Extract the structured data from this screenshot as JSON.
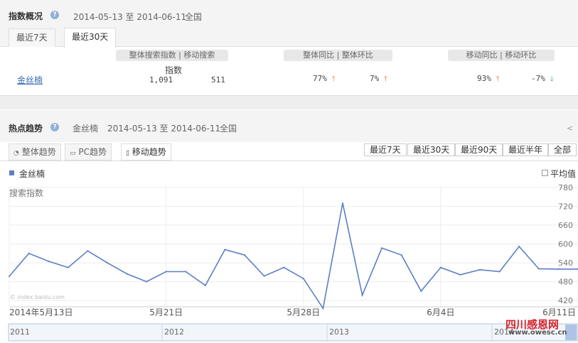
{
  "overview": {
    "title": "指数概况",
    "date_range": "2014-05-13 至 2014-06-11",
    "region": "全国",
    "tabs": [
      "最近7天",
      "最近30天"
    ],
    "active_tab": "最近30天",
    "col_headers": {
      "index": "整体搜索指数 | 移动搜索",
      "index_sub": "指数",
      "yoy_mom": "整体同比 | 整体环比",
      "mobile": "移动同比 | 移动环比"
    },
    "row": {
      "keyword": "金丝楠",
      "overall_index": "1,091",
      "mobile_index": "511",
      "overall_yoy": "77%",
      "overall_mom": "7%",
      "mobile_yoy": "93%",
      "mobile_mom": "-7%"
    }
  },
  "trend": {
    "title": "热点趋势",
    "keyword": "金丝楠",
    "date_range": "2014-05-13 至 2014-06-11",
    "region": "全国",
    "tabs": [
      "整体趋势",
      "PC趋势",
      "移动趋势"
    ],
    "active_tab": "移动趋势",
    "ranges": [
      "最近7天",
      "最近30天",
      "最近90天",
      "最近半年",
      "全部"
    ],
    "legend": "金丝楠",
    "avg_label": "平均值",
    "y_title": "搜索指数",
    "watermark": "© index.baidu.com",
    "navigator_years": [
      "2011",
      "2012",
      "2013",
      "2014"
    ]
  },
  "site_watermark": {
    "name": "四川感恩网",
    "url": "www.owesc.cn"
  },
  "chart_data": {
    "type": "line",
    "title": "",
    "ylabel": "搜索指数",
    "xlabel": "",
    "ylim": [
      400,
      780
    ],
    "yticks": [
      420,
      480,
      540,
      600,
      660,
      720,
      780
    ],
    "x_tick_labels": [
      "2014年5月13日",
      "5月21日",
      "5月28日",
      "6月4日",
      "6月11日"
    ],
    "x_tick_days": [
      0,
      8,
      15,
      22,
      29
    ],
    "grid": true,
    "color": "#5c7fc5",
    "series": [
      {
        "name": "金丝楠",
        "x": [
          0,
          1,
          2,
          3,
          4,
          5,
          6,
          7,
          8,
          9,
          10,
          11,
          12,
          13,
          14,
          15,
          16,
          17,
          18,
          19,
          20,
          21,
          22,
          23,
          24,
          25,
          26,
          27,
          28,
          29
        ],
        "values": [
          497,
          570,
          545,
          525,
          578,
          540,
          505,
          480,
          512,
          512,
          468,
          582,
          565,
          498,
          525,
          490,
          395,
          730,
          437,
          587,
          565,
          450,
          525,
          502,
          518,
          512,
          592,
          521,
          520,
          520
        ]
      }
    ]
  }
}
